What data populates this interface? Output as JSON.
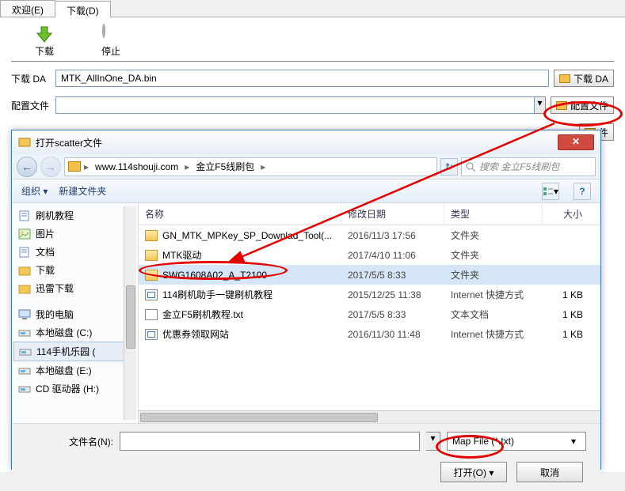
{
  "tabs": {
    "welcome": "欢迎(E)",
    "download": "下载(D)"
  },
  "toolbar": {
    "download": "下载",
    "stop": "停止"
  },
  "form": {
    "da_label": "下载 DA",
    "da_value": "MTK_AllInOne_DA.bin",
    "da_button": "下载 DA",
    "cfg_label": "配置文件",
    "cfg_value": "",
    "cfg_button": "配置文件",
    "extra_button_suffix": "件"
  },
  "dialog": {
    "title": "打开scatter文件",
    "breadcrumbs": [
      "www.114shouji.com",
      "金立F5线刷包"
    ],
    "search_placeholder": "搜索 金立F5线刷包",
    "org": {
      "organize": "组织 ▾",
      "newfolder": "新建文件夹"
    },
    "columns": {
      "name": "名称",
      "date": "修改日期",
      "type": "类型",
      "size": "大小"
    },
    "sidebar": {
      "items": [
        {
          "label": "刷机教程",
          "icon": "doc"
        },
        {
          "label": "图片",
          "icon": "pic"
        },
        {
          "label": "文档",
          "icon": "doc"
        },
        {
          "label": "下载",
          "icon": "folder"
        },
        {
          "label": "迅雷下载",
          "icon": "folder"
        }
      ],
      "group": "我的电脑",
      "drives": [
        {
          "label": "本地磁盘 (C:)"
        },
        {
          "label": "114手机乐园 (",
          "selected": true
        },
        {
          "label": "本地磁盘 (E:)"
        },
        {
          "label": "CD 驱动器 (H:)"
        }
      ]
    },
    "files": [
      {
        "name": "GN_MTK_MPKey_SP_Downlad_Tool(...",
        "date": "2016/11/3 17:56",
        "type": "文件夹",
        "size": "",
        "icon": "folder"
      },
      {
        "name": "MTK驱动",
        "date": "2017/4/10 11:06",
        "type": "文件夹",
        "size": "",
        "icon": "folder"
      },
      {
        "name": "SWG1608A02_A_T2100",
        "date": "2017/5/5 8:33",
        "type": "文件夹",
        "size": "",
        "icon": "folder",
        "selected": true
      },
      {
        "name": "114刷机助手一键刷机教程",
        "date": "2015/12/25 11:38",
        "type": "Internet 快捷方式",
        "size": "1 KB",
        "icon": "url"
      },
      {
        "name": "金立F5刷机教程.txt",
        "date": "2017/5/5 8:33",
        "type": "文本文档",
        "size": "1 KB",
        "icon": "txt"
      },
      {
        "name": "优惠券领取网站",
        "date": "2016/11/30 11:48",
        "type": "Internet 快捷方式",
        "size": "1 KB",
        "icon": "url"
      }
    ],
    "bottom": {
      "filename_label": "文件名(N):",
      "filename_value": "",
      "filter": "Map File (*.txt)",
      "open": "打开(O)",
      "cancel": "取消"
    }
  }
}
